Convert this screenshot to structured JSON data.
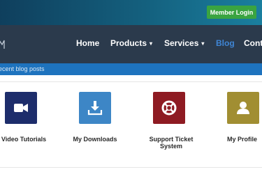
{
  "header": {
    "member_login": "Member Login"
  },
  "nav": {
    "items": [
      {
        "label": "Home",
        "dropdown": false,
        "active": false
      },
      {
        "label": "Products",
        "dropdown": true,
        "active": false
      },
      {
        "label": "Services",
        "dropdown": true,
        "active": false
      },
      {
        "label": "Blog",
        "dropdown": false,
        "active": true
      },
      {
        "label": "Cont",
        "dropdown": false,
        "active": false
      }
    ]
  },
  "blog_strip": {
    "text": "ecent blog posts"
  },
  "tiles": [
    {
      "label": "Video Tutorials",
      "icon": "video-camera-icon",
      "color": "#1d2d6b"
    },
    {
      "label": "My Downloads",
      "icon": "download-tray-icon",
      "color": "#3d86c6"
    },
    {
      "label": "Support Ticket System",
      "label_lines": [
        "Support Ticket",
        "System"
      ],
      "icon": "lifebuoy-icon",
      "color": "#8e1b22"
    },
    {
      "label": "My Profile",
      "icon": "user-icon",
      "color": "#a18e32"
    }
  ],
  "colors": {
    "topbar": "#14607e",
    "navbar": "#2b3a4c",
    "accent_blue": "#1e73be",
    "nav_active": "#3f86d6",
    "login_green": "#3aa441"
  }
}
